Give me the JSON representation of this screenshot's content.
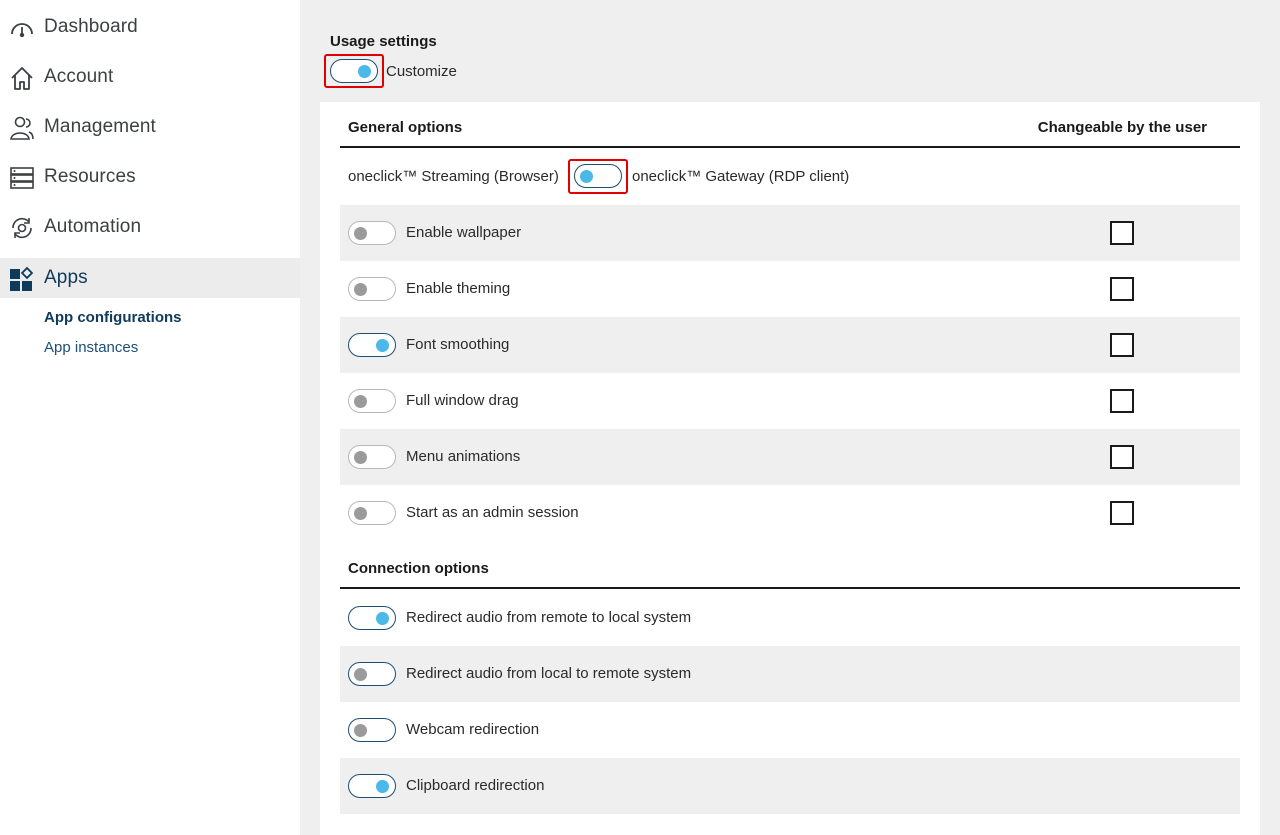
{
  "sidebar": {
    "items": [
      {
        "label": "Dashboard",
        "icon": "gauge-icon"
      },
      {
        "label": "Account",
        "icon": "home-icon"
      },
      {
        "label": "Management",
        "icon": "users-icon"
      },
      {
        "label": "Resources",
        "icon": "server-icon"
      },
      {
        "label": "Automation",
        "icon": "automation-icon"
      },
      {
        "label": "Apps",
        "icon": "apps-icon"
      }
    ],
    "sub_items": [
      {
        "label": "App configurations"
      },
      {
        "label": "App instances"
      }
    ]
  },
  "usage": {
    "title": "Usage settings",
    "customize_label": "Customize",
    "customize_on": true
  },
  "general": {
    "header": "General options",
    "changeable_header": "Changeable by the user",
    "streaming_label": "oneclick™ Streaming (Browser)",
    "gateway_label": "oneclick™ Gateway (RDP client)",
    "options": [
      {
        "label": "Enable wallpaper",
        "on": false
      },
      {
        "label": "Enable theming",
        "on": false
      },
      {
        "label": "Font smoothing",
        "on": true
      },
      {
        "label": "Full window drag",
        "on": false
      },
      {
        "label": "Menu animations",
        "on": false
      },
      {
        "label": "Start as an admin session",
        "on": false
      }
    ]
  },
  "connection": {
    "header": "Connection options",
    "options": [
      {
        "label": "Redirect audio from remote to local system",
        "on": true
      },
      {
        "label": "Redirect audio from local to remote system",
        "on": false
      },
      {
        "label": "Webcam redirection",
        "on": false
      },
      {
        "label": "Clipboard redirection",
        "on": true
      }
    ]
  },
  "colors": {
    "accent": "#4bb8e8",
    "dark_blue": "#1d4e74",
    "highlight": "#e00000"
  }
}
